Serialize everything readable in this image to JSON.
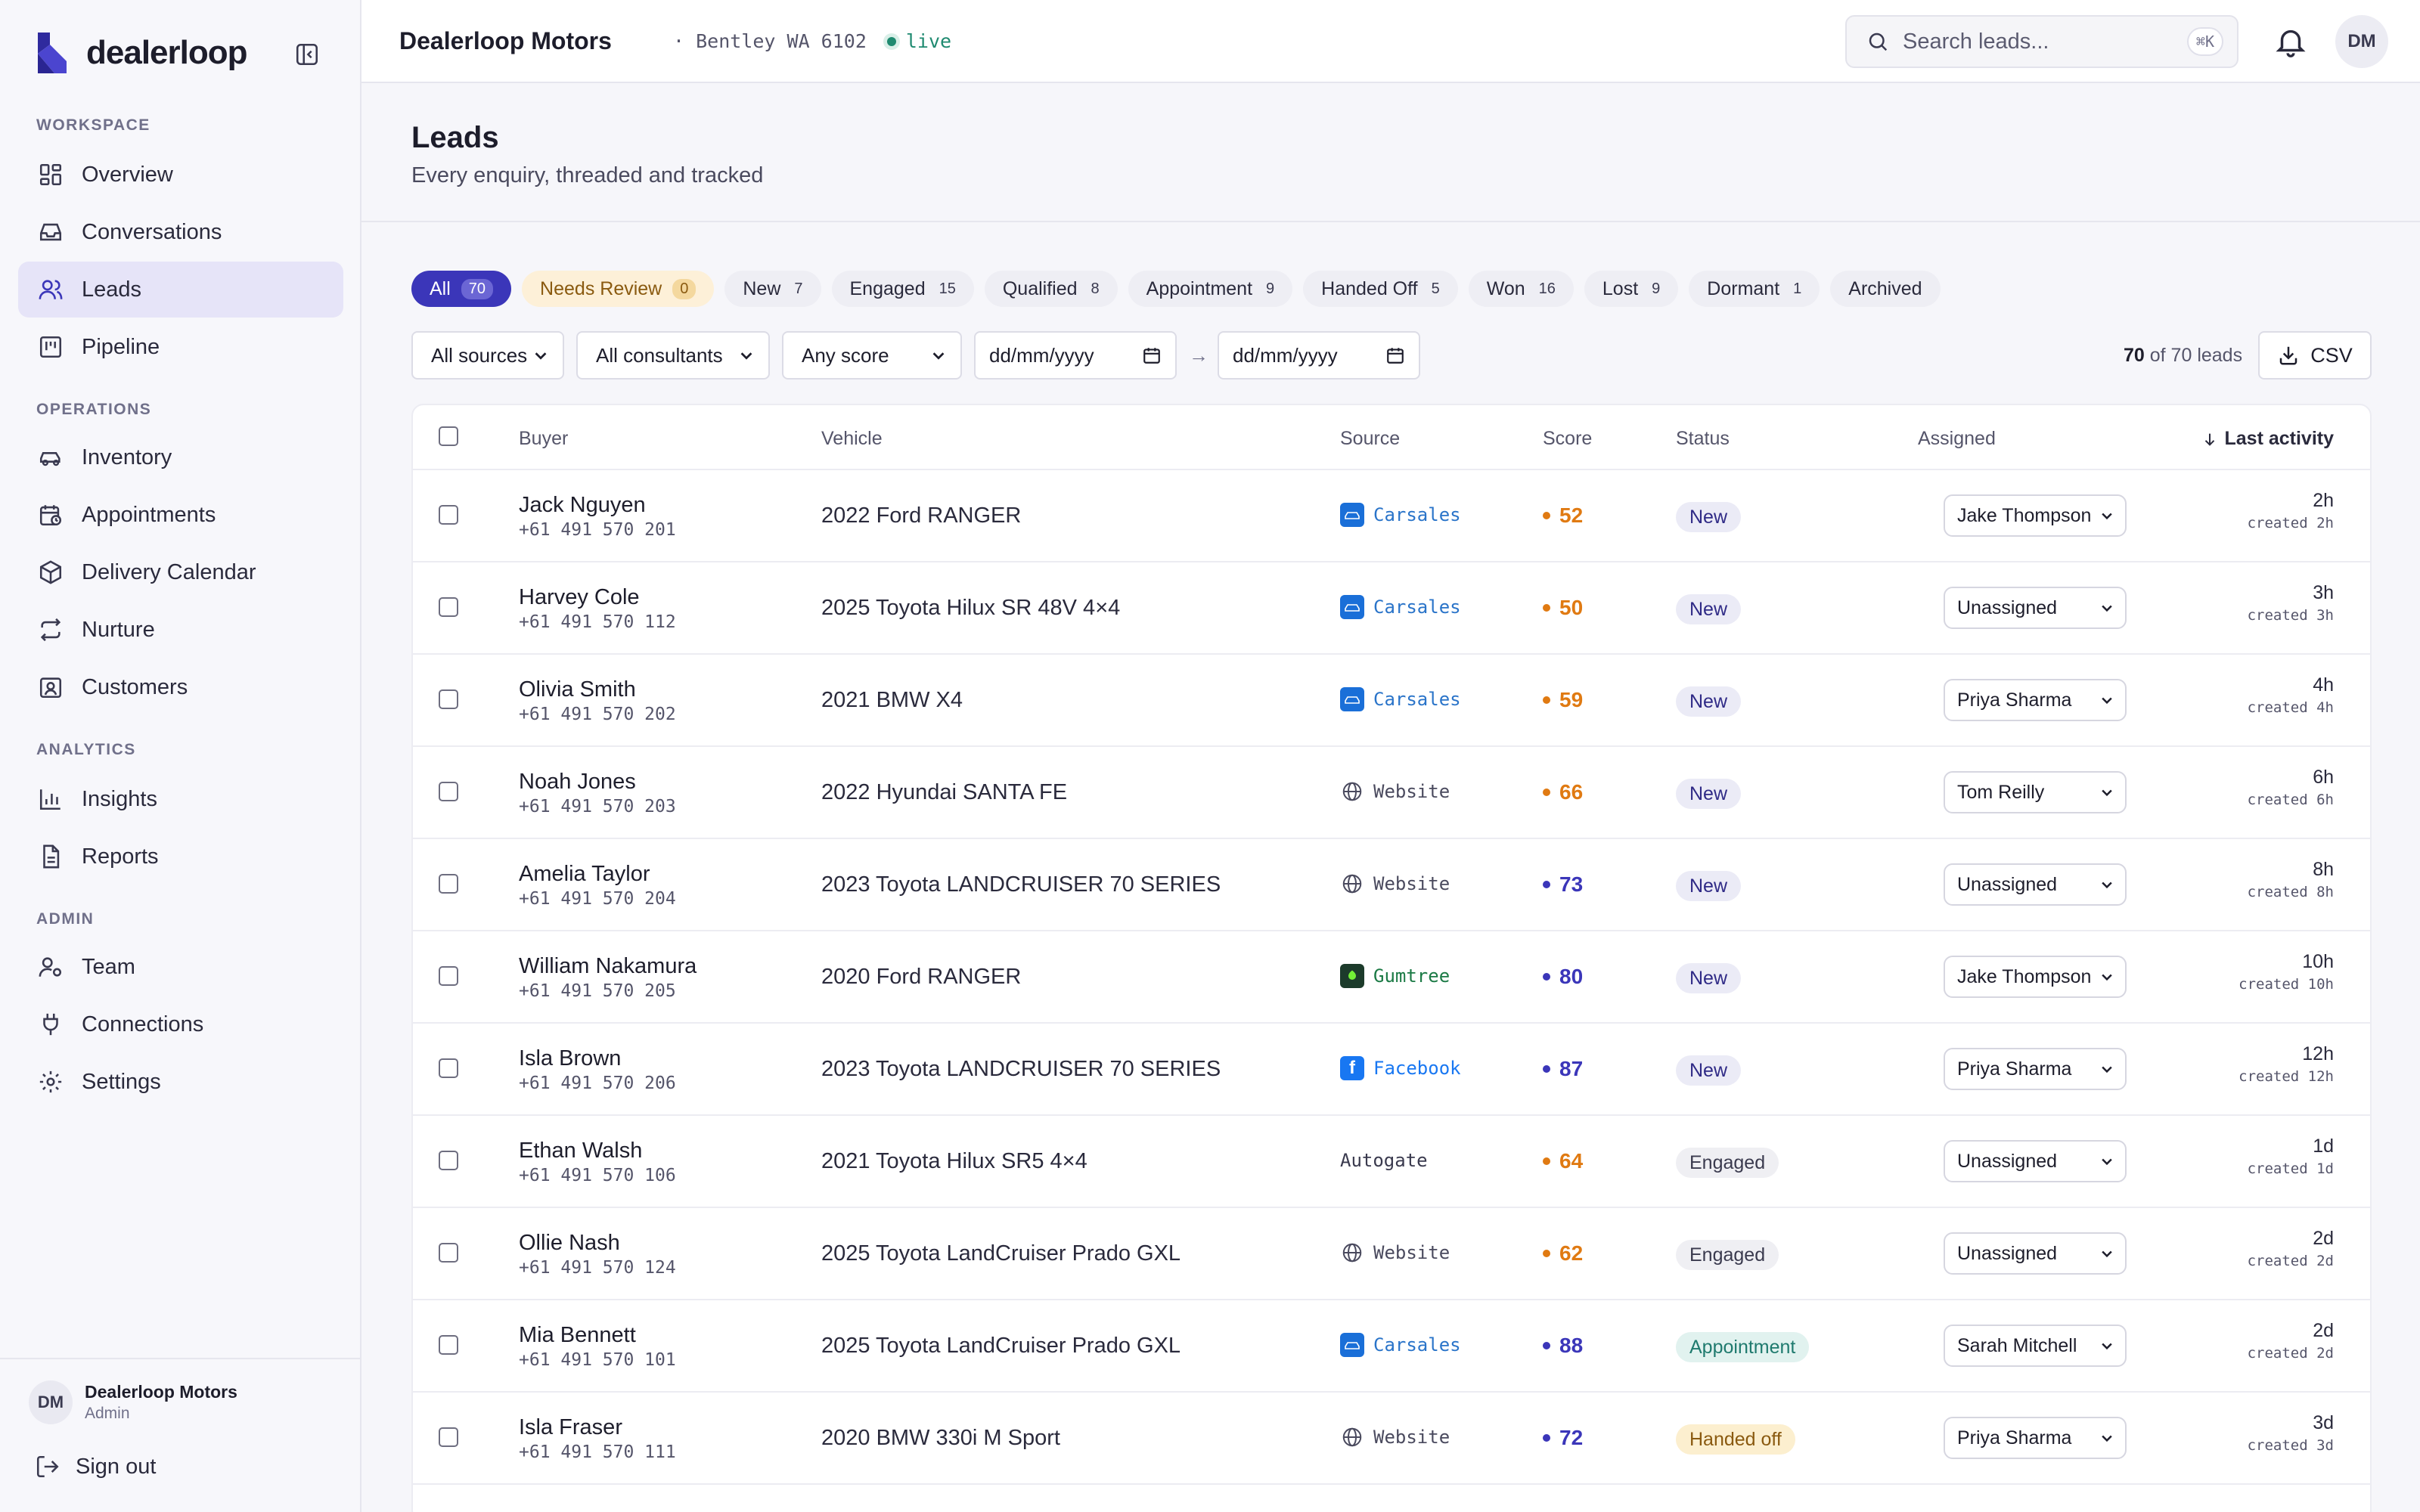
{
  "brand": {
    "name": "dealerloop",
    "accent": "#3b36b9"
  },
  "sidebar": {
    "sections": [
      {
        "label": "WORKSPACE"
      },
      {
        "label": "OPERATIONS"
      },
      {
        "label": "ANALYTICS"
      },
      {
        "label": "ADMIN"
      }
    ],
    "items": [
      {
        "label": "Overview",
        "icon": "dashboard-icon"
      },
      {
        "label": "Conversations",
        "icon": "inbox-icon"
      },
      {
        "label": "Leads",
        "icon": "users-icon",
        "active": true
      },
      {
        "label": "Pipeline",
        "icon": "kanban-icon"
      },
      {
        "label": "Inventory",
        "icon": "car-icon"
      },
      {
        "label": "Appointments",
        "icon": "calendar-clock-icon"
      },
      {
        "label": "Delivery Calendar",
        "icon": "package-icon"
      },
      {
        "label": "Nurture",
        "icon": "repeat-icon"
      },
      {
        "label": "Customers",
        "icon": "contact-icon"
      },
      {
        "label": "Insights",
        "icon": "bar-chart-icon"
      },
      {
        "label": "Reports",
        "icon": "file-icon"
      },
      {
        "label": "Team",
        "icon": "user-cog-icon"
      },
      {
        "label": "Connections",
        "icon": "plug-icon"
      },
      {
        "label": "Settings",
        "icon": "gear-icon"
      }
    ],
    "footer": {
      "avatar": "DM",
      "org": "Dealerloop Motors",
      "role": "Admin",
      "signout": "Sign out"
    }
  },
  "topbar": {
    "dealer": "Dealerloop Motors",
    "location": "· Bentley WA 6102",
    "live": "live",
    "search_placeholder": "Search leads...",
    "search_shortcut": "⌘K",
    "user_initials": "DM"
  },
  "page": {
    "title": "Leads",
    "subtitle": "Every enquiry, threaded and tracked"
  },
  "tabs": [
    {
      "label": "All",
      "count": "70"
    },
    {
      "label": "Needs Review",
      "count": "0"
    },
    {
      "label": "New",
      "count": "7"
    },
    {
      "label": "Engaged",
      "count": "15"
    },
    {
      "label": "Qualified",
      "count": "8"
    },
    {
      "label": "Appointment",
      "count": "9"
    },
    {
      "label": "Handed Off",
      "count": "5"
    },
    {
      "label": "Won",
      "count": "16"
    },
    {
      "label": "Lost",
      "count": "9"
    },
    {
      "label": "Dormant",
      "count": "1"
    },
    {
      "label": "Archived",
      "count": ""
    }
  ],
  "filters": {
    "sources": "All sources",
    "consultants": "All consultants",
    "score": "Any score",
    "date_from": "dd/mm/yyyy",
    "date_to": "dd/mm/yyyy",
    "arrow": "→",
    "shown": "70",
    "of_text": "of 70 leads",
    "csv": "CSV"
  },
  "table": {
    "headers": {
      "buyer": "Buyer",
      "vehicle": "Vehicle",
      "source": "Source",
      "score": "Score",
      "status": "Status",
      "assigned": "Assigned",
      "activity": "Last activity"
    },
    "rows": [
      {
        "name": "Jack Nguyen",
        "phone": "+61 491 570 201",
        "vehicle": "2022 Ford RANGER",
        "source": "Carsales",
        "score": "52",
        "status": "New",
        "assigned": "Jake Thompson",
        "activity": "2h",
        "created": "created 2h"
      },
      {
        "name": "Harvey Cole",
        "phone": "+61 491 570 112",
        "vehicle": "2025 Toyota Hilux SR 48V 4×4",
        "source": "Carsales",
        "score": "50",
        "status": "New",
        "assigned": "Unassigned",
        "activity": "3h",
        "created": "created 3h"
      },
      {
        "name": "Olivia Smith",
        "phone": "+61 491 570 202",
        "vehicle": "2021 BMW X4",
        "source": "Carsales",
        "score": "59",
        "status": "New",
        "assigned": "Priya Sharma",
        "activity": "4h",
        "created": "created 4h"
      },
      {
        "name": "Noah Jones",
        "phone": "+61 491 570 203",
        "vehicle": "2022 Hyundai SANTA FE",
        "source": "Website",
        "score": "66",
        "status": "New",
        "assigned": "Tom Reilly",
        "activity": "6h",
        "created": "created 6h"
      },
      {
        "name": "Amelia Taylor",
        "phone": "+61 491 570 204",
        "vehicle": "2023 Toyota LANDCRUISER 70 SERIES",
        "source": "Website",
        "score": "73",
        "status": "New",
        "assigned": "Unassigned",
        "activity": "8h",
        "created": "created 8h"
      },
      {
        "name": "William Nakamura",
        "phone": "+61 491 570 205",
        "vehicle": "2020 Ford RANGER",
        "source": "Gumtree",
        "score": "80",
        "status": "New",
        "assigned": "Jake Thompson",
        "activity": "10h",
        "created": "created 10h"
      },
      {
        "name": "Isla Brown",
        "phone": "+61 491 570 206",
        "vehicle": "2023 Toyota LANDCRUISER 70 SERIES",
        "source": "Facebook",
        "score": "87",
        "status": "New",
        "assigned": "Priya Sharma",
        "activity": "12h",
        "created": "created 12h"
      },
      {
        "name": "Ethan Walsh",
        "phone": "+61 491 570 106",
        "vehicle": "2021 Toyota Hilux SR5 4×4",
        "source": "Autogate",
        "score": "64",
        "status": "Engaged",
        "assigned": "Unassigned",
        "activity": "1d",
        "created": "created 1d"
      },
      {
        "name": "Ollie Nash",
        "phone": "+61 491 570 124",
        "vehicle": "2025 Toyota LandCruiser Prado GXL",
        "source": "Website",
        "score": "62",
        "status": "Engaged",
        "assigned": "Unassigned",
        "activity": "2d",
        "created": "created 2d"
      },
      {
        "name": "Mia Bennett",
        "phone": "+61 491 570 101",
        "vehicle": "2025 Toyota LandCruiser Prado GXL",
        "source": "Carsales",
        "score": "88",
        "status": "Appointment",
        "assigned": "Sarah Mitchell",
        "activity": "2d",
        "created": "created 2d"
      },
      {
        "name": "Isla Fraser",
        "phone": "+61 491 570 111",
        "vehicle": "2020 BMW 330i M Sport",
        "source": "Website",
        "score": "72",
        "status": "Handed off",
        "assigned": "Priya Sharma",
        "activity": "3d",
        "created": "created 3d"
      }
    ]
  }
}
